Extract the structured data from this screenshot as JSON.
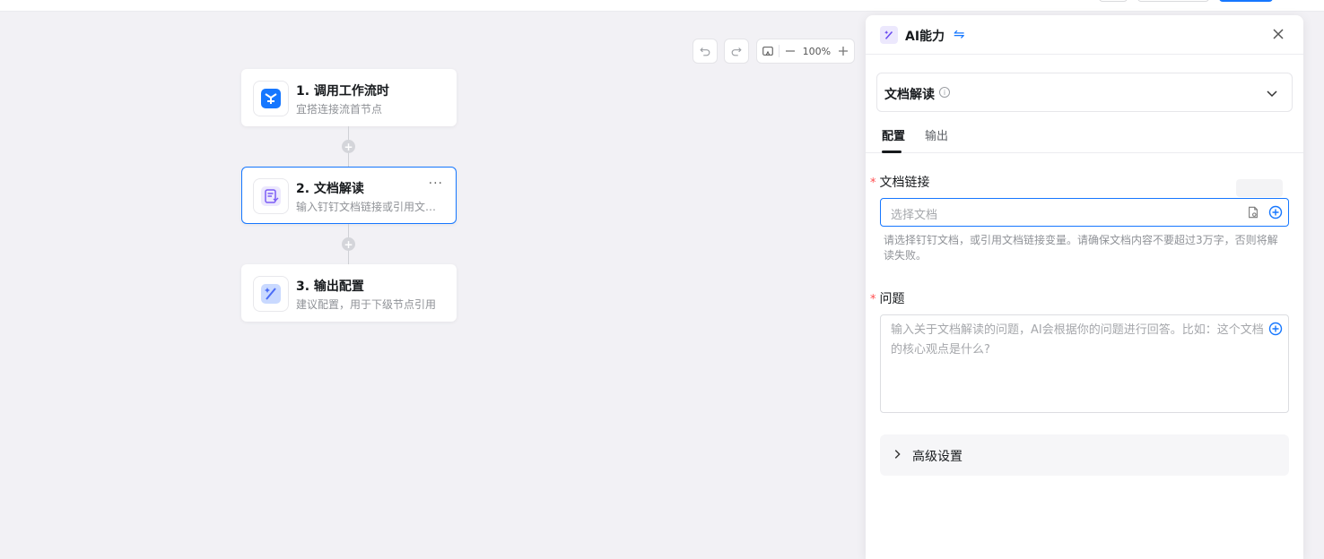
{
  "canvas": {
    "zoom": "100%",
    "nodes": [
      {
        "title": "1. 调用工作流时",
        "subtitle": "宜搭连接流首节点",
        "icon": "yida-icon"
      },
      {
        "title": "2. 文档解读",
        "subtitle": "输入钉钉文档链接或引用文档链接变量",
        "icon": "doc-read-icon",
        "more": "···"
      },
      {
        "title": "3. 输出配置",
        "subtitle": "建议配置，用于下级节点引用",
        "icon": "magic-wand-icon"
      }
    ]
  },
  "panel": {
    "title": "AI能力",
    "swap_glyph": "⇋",
    "selector_label": "文档解读",
    "info_glyph": "i",
    "tabs": [
      "配置",
      "输出"
    ],
    "fields": {
      "doc_link": {
        "required_mark": "*",
        "label": "文档链接",
        "placeholder": "选择文档",
        "help": "请选择钉钉文档，或引用文档链接变量。请确保文档内容不要超过3万字，否则将解读失败。"
      },
      "question": {
        "required_mark": "*",
        "label": "问题",
        "placeholder": "输入关于文档解读的问题，AI会根据你的问题进行回答。比如：这个文档的核心观点是什么?"
      }
    },
    "advanced_label": "高级设置"
  },
  "colors": {
    "accent": "#1677ff",
    "required": "#ff4d4f",
    "canvas_bg": "#f2f1f5"
  }
}
